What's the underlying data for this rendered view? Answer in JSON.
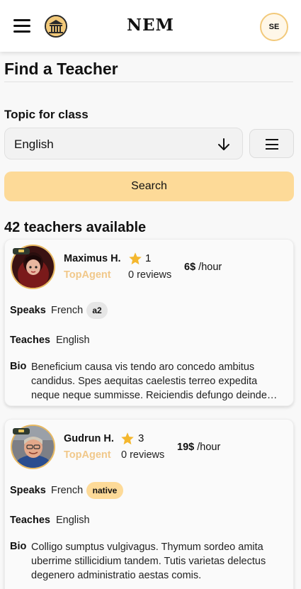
{
  "header": {
    "brand": "NEM",
    "user_initials": "SE",
    "menu_icon": "hamburger-menu-icon",
    "logo_icon": "building-logo-icon"
  },
  "page": {
    "title": "Find a Teacher"
  },
  "filters": {
    "topic_label": "Topic for class",
    "topic_value": "English",
    "search_label": "Search",
    "filter_icon": "filter-menu-icon",
    "dropdown_icon": "arrow-down-icon"
  },
  "results": {
    "count_text": "42 teachers available"
  },
  "colors": {
    "accent": "#fdda98",
    "agent_text": "#f1c88a",
    "native_badge": "#fdda98",
    "level_badge": "#e6e6e6"
  },
  "teachers": [
    {
      "name": "Maximus H.",
      "badge": "TopAgent",
      "rating": "1",
      "reviews": "0 reviews",
      "price": "6$",
      "per": "/hour",
      "speaks_label": "Speaks",
      "speaks_lang": "French",
      "speaks_level": "a2",
      "teaches_label": "Teaches",
      "teaches_value": "English",
      "bio_label": "Bio",
      "bio": "Beneficium causa vis tendo aro concedo ambitus candidus. Spes aequitas caelestis terreo expedita neque neque summisse. Reiciendis defungo deinde…"
    },
    {
      "name": "Gudrun H.",
      "badge": "TopAgent",
      "rating": "3",
      "reviews": "0 reviews",
      "price": "19$",
      "per": "/hour",
      "speaks_label": "Speaks",
      "speaks_lang": "French",
      "speaks_level": "native",
      "teaches_label": "Teaches",
      "teaches_value": "English",
      "bio_label": "Bio",
      "bio": "Colligo sumptus vulgivagus. Thymum sordeo amita uberrime stillicidium tandem. Tutis varietas delectus degenero administratio aestas comis."
    }
  ]
}
